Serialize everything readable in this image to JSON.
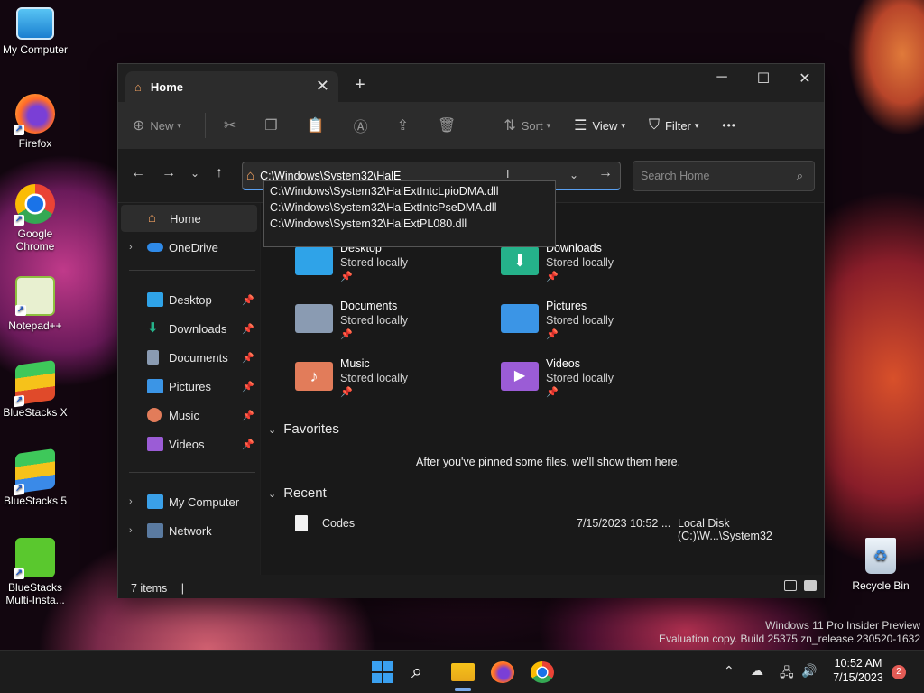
{
  "desktop": {
    "icons": [
      {
        "label": "My Computer"
      },
      {
        "label": "Firefox"
      },
      {
        "label": "Google Chrome"
      },
      {
        "label": "Notepad++"
      },
      {
        "label": "BlueStacks X"
      },
      {
        "label": "BlueStacks 5"
      },
      {
        "label": "BlueStacks Multi-Insta..."
      }
    ],
    "recycle_bin": "Recycle Bin",
    "watermark": {
      "line1": "Windows 11 Pro Insider Preview",
      "line2": "Evaluation copy. Build 25375.zn_release.230520-1632"
    }
  },
  "window": {
    "tab": {
      "title": "Home",
      "close": "✕"
    },
    "new_tab": "+",
    "controls": {
      "minimize": "─",
      "maximize": "☐",
      "close": "✕"
    },
    "toolbar": {
      "new": "New",
      "sort": "Sort",
      "view": "View",
      "filter": "Filter",
      "more": "•••"
    },
    "address": {
      "value": "C:\\Windows\\System32\\HalE",
      "suggestions": [
        "C:\\Windows\\System32\\HalExtIntcLpioDMA.dll",
        "C:\\Windows\\System32\\HalExtIntcPseDMA.dll",
        "C:\\Windows\\System32\\HalExtPL080.dll"
      ]
    },
    "search": {
      "placeholder": "Search Home"
    },
    "sidebar": {
      "home": "Home",
      "onedrive": "OneDrive",
      "pinned": [
        {
          "label": "Desktop"
        },
        {
          "label": "Downloads"
        },
        {
          "label": "Documents"
        },
        {
          "label": "Pictures"
        },
        {
          "label": "Music"
        },
        {
          "label": "Videos"
        }
      ],
      "my_computer": "My Computer",
      "network": "Network"
    },
    "quick_access": [
      {
        "name": "Desktop",
        "status": "Stored locally",
        "color": "#2fa3e8"
      },
      {
        "name": "Downloads",
        "status": "Stored locally",
        "color": "#25b28a"
      },
      {
        "name": "Documents",
        "status": "Stored locally",
        "color": "#8a9bb2"
      },
      {
        "name": "Pictures",
        "status": "Stored locally",
        "color": "#3b95e6"
      },
      {
        "name": "Music",
        "status": "Stored locally",
        "color": "#e27c5a"
      },
      {
        "name": "Videos",
        "status": "Stored locally",
        "color": "#9b5cd6"
      }
    ],
    "favorites": {
      "title": "Favorites",
      "empty_message": "After you've pinned some files, we'll show them here."
    },
    "recent": {
      "title": "Recent",
      "items": [
        {
          "name": "Codes",
          "date": "7/15/2023 10:52 ...",
          "location": "Local Disk (C:)\\W...\\System32"
        }
      ]
    },
    "status": {
      "items": "7 items"
    }
  },
  "taskbar": {
    "time": "10:52 AM",
    "date": "7/15/2023",
    "notifications": "2"
  }
}
